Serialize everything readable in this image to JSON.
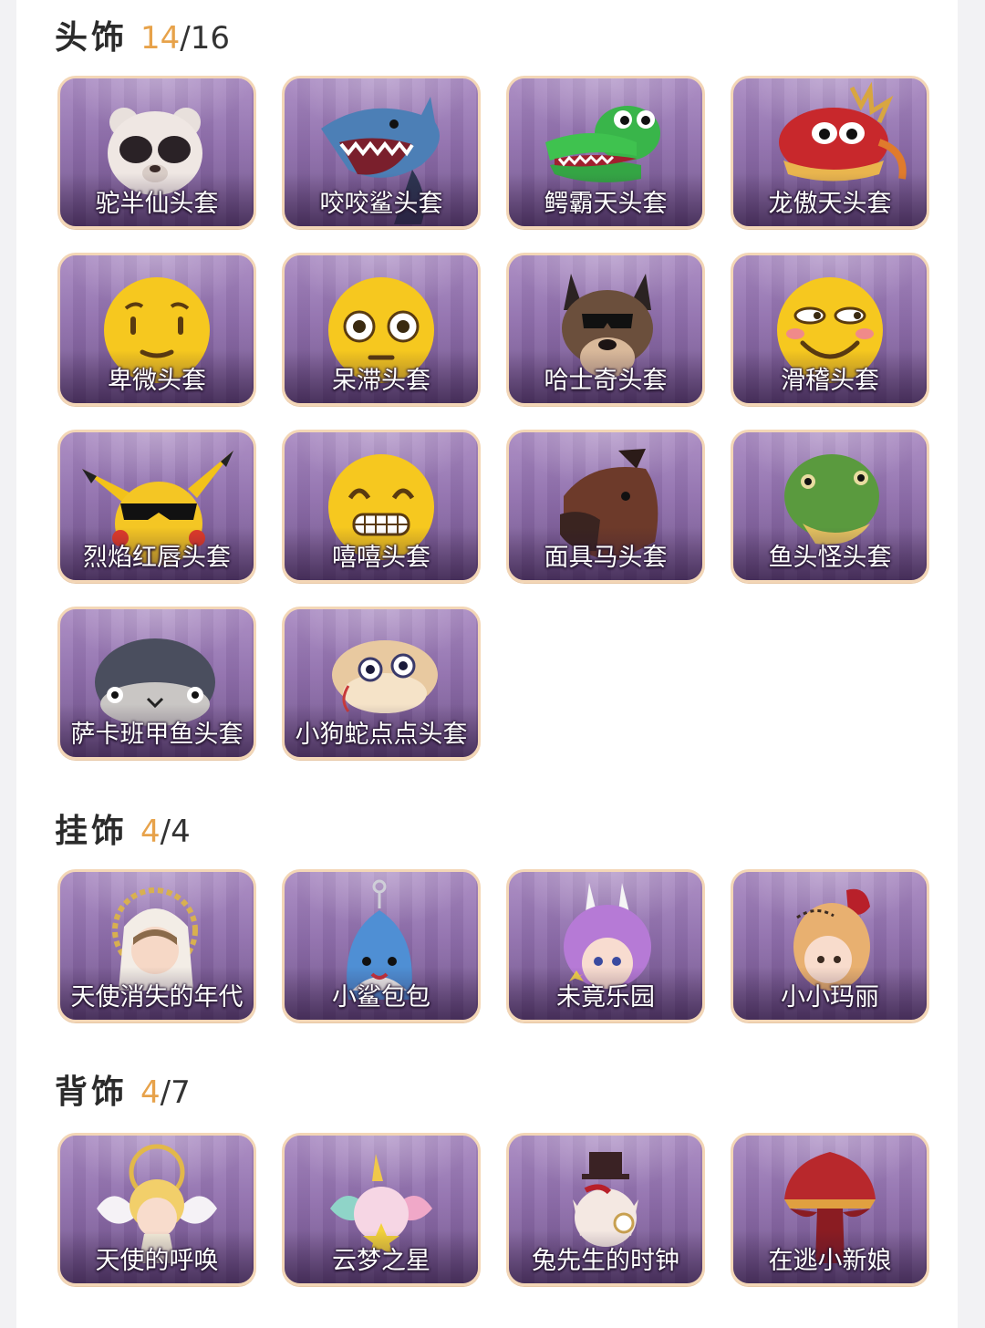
{
  "sections": {
    "headwear": {
      "title": "头饰",
      "owned": "14",
      "sep": "/",
      "total": "16",
      "items": [
        {
          "label": "驼半仙头套",
          "icon": "bear-sunglasses-mask-icon"
        },
        {
          "label": "咬咬鲨头套",
          "icon": "shark-mask-icon"
        },
        {
          "label": "鳄霸天头套",
          "icon": "crocodile-mask-icon"
        },
        {
          "label": "龙傲天头套",
          "icon": "dragon-mask-icon"
        },
        {
          "label": "卑微头套",
          "icon": "humble-emoji-mask-icon"
        },
        {
          "label": "呆滞头套",
          "icon": "blank-stare-emoji-mask-icon"
        },
        {
          "label": "哈士奇头套",
          "icon": "husky-mask-icon"
        },
        {
          "label": "滑稽头套",
          "icon": "funny-emoji-mask-icon"
        },
        {
          "label": "烈焰红唇头套",
          "icon": "pikachu-sunglasses-mask-icon"
        },
        {
          "label": "嘻嘻头套",
          "icon": "grin-emoji-mask-icon"
        },
        {
          "label": "面具马头套",
          "icon": "horse-mask-icon"
        },
        {
          "label": "鱼头怪头套",
          "icon": "fish-head-mask-icon"
        },
        {
          "label": "萨卡班甲鱼头套",
          "icon": "sacabambaspis-mask-icon"
        },
        {
          "label": "小狗蛇点点头套",
          "icon": "puppy-snake-mask-icon"
        }
      ]
    },
    "hanging": {
      "title": "挂饰",
      "owned": "4",
      "sep": "/",
      "total": "4",
      "items": [
        {
          "label": "天使消失的年代",
          "icon": "angel-doll-charm-icon"
        },
        {
          "label": "小鲨包包",
          "icon": "shark-bag-charm-icon"
        },
        {
          "label": "未竟乐园",
          "icon": "bunny-girl-charm-icon"
        },
        {
          "label": "小小玛丽",
          "icon": "mary-doll-charm-icon"
        }
      ]
    },
    "back": {
      "title": "背饰",
      "owned": "4",
      "sep": "/",
      "total": "7",
      "items": [
        {
          "label": "天使的呼唤",
          "icon": "angel-wings-back-icon"
        },
        {
          "label": "云梦之星",
          "icon": "unicorn-star-back-icon"
        },
        {
          "label": "兔先生的时钟",
          "icon": "rabbit-clock-back-icon"
        },
        {
          "label": "在逃小新娘",
          "icon": "bride-dress-back-icon"
        }
      ]
    }
  },
  "colors": {
    "accent_count": "#e7a24a",
    "card_border": "#f3d6b6",
    "card_bg": "#8f6eac"
  }
}
